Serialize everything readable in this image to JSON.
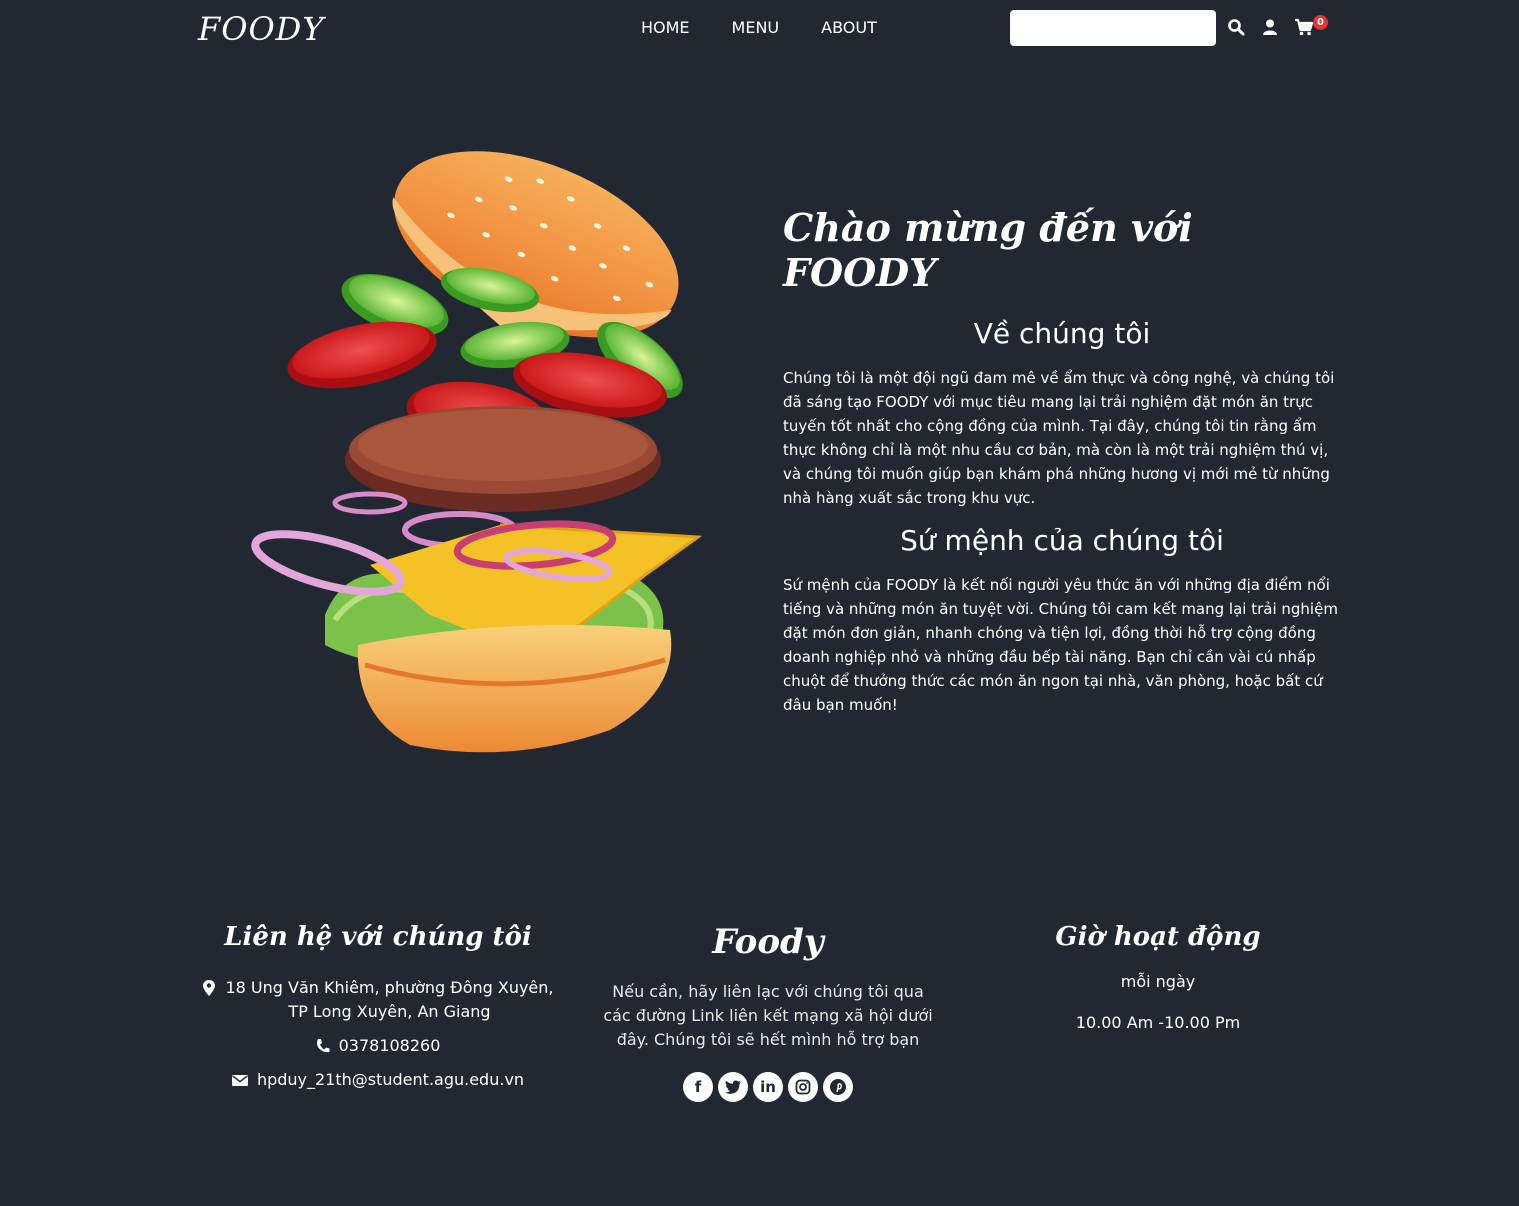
{
  "header": {
    "logo": "FOODY",
    "nav": [
      "HOME",
      "MENU",
      "ABOUT"
    ],
    "search_placeholder": "",
    "cart_count": "0",
    "icons": [
      "search-icon",
      "user-icon",
      "cart-icon"
    ]
  },
  "hero": {
    "welcome": "Chào mừng đến với FOODY",
    "about_title": "Về chúng tôi",
    "about_text": "Chúng tôi là một đội ngũ đam mê về ẩm thực và công nghệ, và chúng tôi đã sáng tạo FOODY với mục tiêu mang lại trải nghiệm đặt món ăn trực tuyến tốt nhất cho cộng đồng của mình. Tại đây, chúng tôi tin rằng ẩm thực không chỉ là một nhu cầu cơ bản, mà còn là một trải nghiệm thú vị, và chúng tôi muốn giúp bạn khám phá những hương vị mới mẻ từ những nhà hàng xuất sắc trong khu vực.",
    "mission_title": "Sứ mệnh của chúng tôi",
    "mission_text": "Sứ mệnh của FOODY là kết nối người yêu thức ăn với những địa điểm nổi tiếng và những món ăn tuyệt vời. Chúng tôi cam kết mang lại trải nghiệm đặt món đơn giản, nhanh chóng và tiện lợi, đồng thời hỗ trợ cộng đồng doanh nghiệp nhỏ và những đầu bếp tài năng. Bạn chỉ cần vài cú nhấp chuột để thưởng thức các món ăn ngon tại nhà, văn phòng, hoặc bất cứ đâu bạn muốn!"
  },
  "footer": {
    "contact": {
      "title": "Liên hệ với chúng tôi",
      "address": "18 Ung Văn Khiêm, phường Đông Xuyên, TP Long Xuyên, An Giang",
      "phone": "0378108260",
      "email": "hpduy_21th@student.agu.edu.vn"
    },
    "brand": {
      "title": "Foody",
      "text": "Nếu cần, hãy liên lạc với chúng tôi qua các đường Link liên kết mạng xã hội dưới đây. Chúng tôi sẽ hết mình hỗ trợ bạn",
      "socials": [
        "facebook-icon",
        "twitter-icon",
        "linkedin-icon",
        "instagram-icon",
        "pinterest-icon"
      ]
    },
    "hours": {
      "title": "Giờ hoạt động",
      "days": "mỗi ngày",
      "time": "10.00 Am -10.00 Pm"
    }
  },
  "colors": {
    "background": "#222831",
    "badge": "#e3342f",
    "text": "#ffffff"
  }
}
